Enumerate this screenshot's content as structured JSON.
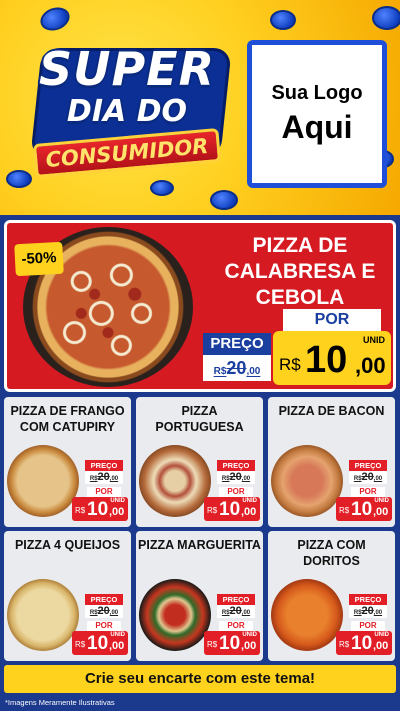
{
  "header": {
    "title_line1": "SUPER",
    "title_line2": "DIA DO",
    "title_line3": "CONSUMIDOR",
    "logo_line1": "Sua Logo",
    "logo_line2": "Aqui"
  },
  "featured": {
    "discount": "-50%",
    "name": "PIZZA DE CALABRESA E CEBOLA",
    "price_label": "PREÇO",
    "old_currency": "R$",
    "old_price_int": "20",
    "old_price_dec": ",00",
    "por_label": "POR",
    "unit_label": "UNID",
    "new_currency": "R$",
    "new_price_int": "10",
    "new_price_dec": ",00"
  },
  "products": [
    {
      "name": "PIZZA DE FRANGO COM CATUPIRY",
      "price_label": "PREÇO",
      "old_currency": "R$",
      "old_price_int": "20",
      "old_price_dec": ",00",
      "por_label": "POR",
      "unit_label": "UNID",
      "new_currency": "R$",
      "new_price_int": "10",
      "new_price_dec": ",00"
    },
    {
      "name": "PIZZA PORTUGUESA",
      "price_label": "PREÇO",
      "old_currency": "R$",
      "old_price_int": "20",
      "old_price_dec": ",00",
      "por_label": "POR",
      "unit_label": "UNID",
      "new_currency": "R$",
      "new_price_int": "10",
      "new_price_dec": ",00"
    },
    {
      "name": "PIZZA DE BACON",
      "price_label": "PREÇO",
      "old_currency": "R$",
      "old_price_int": "20",
      "old_price_dec": ",00",
      "por_label": "POR",
      "unit_label": "UNID",
      "new_currency": "R$",
      "new_price_int": "10",
      "new_price_dec": ",00"
    },
    {
      "name": "PIZZA 4 QUEIJOS",
      "price_label": "PREÇO",
      "old_currency": "R$",
      "old_price_int": "20",
      "old_price_dec": ",00",
      "por_label": "POR",
      "unit_label": "UNID",
      "new_currency": "R$",
      "new_price_int": "10",
      "new_price_dec": ",00"
    },
    {
      "name": "PIZZA MARGUERITA",
      "price_label": "PREÇO",
      "old_currency": "R$",
      "old_price_int": "20",
      "old_price_dec": ",00",
      "por_label": "POR",
      "unit_label": "UNID",
      "new_currency": "R$",
      "new_price_int": "10",
      "new_price_dec": ",00"
    },
    {
      "name": "PIZZA COM DORITOS",
      "price_label": "PREÇO",
      "old_currency": "R$",
      "old_price_int": "20",
      "old_price_dec": ",00",
      "por_label": "POR",
      "unit_label": "UNID",
      "new_currency": "R$",
      "new_price_int": "10",
      "new_price_dec": ",00"
    }
  ],
  "footer": {
    "cta": "Crie seu encarte com este tema!",
    "disclaimer": "*Imagens Meramente Ilustrativas"
  },
  "colors": {
    "header_yellow": "#ffcf1f",
    "brand_blue": "#1b3a8e",
    "hero_red": "#d51a22",
    "price_yellow": "#ffd21e",
    "price_red": "#e21f26"
  }
}
